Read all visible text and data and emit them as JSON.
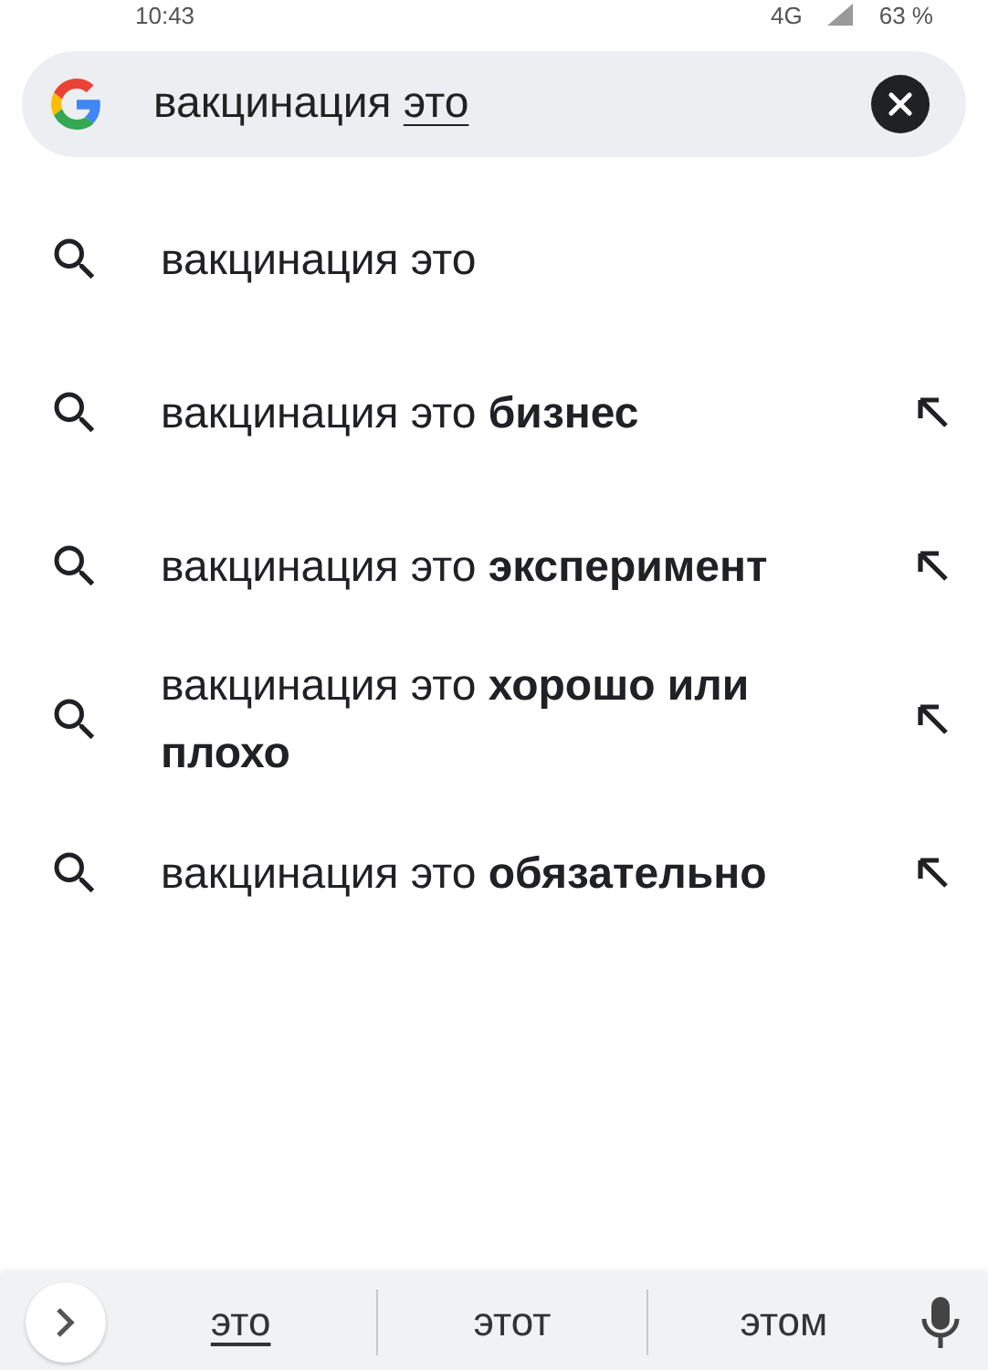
{
  "status_bar": {
    "time": "10:43",
    "network": "4G",
    "battery": "63 %"
  },
  "search": {
    "text": "вакцинация",
    "composing": "это"
  },
  "suggestions": [
    {
      "text": "вакцинация это",
      "fill_arrow": false
    },
    {
      "text": "вакцинация это **бизнес**",
      "fill_arrow": true
    },
    {
      "text": "вакцинация это **эксперимент**",
      "fill_arrow": true
    },
    {
      "text": "вакцинация это **хорошо или плохо**",
      "fill_arrow": true
    },
    {
      "text": "вакцинация это **обязательно**",
      "fill_arrow": true
    }
  ],
  "keyboard_suggestions": [
    {
      "label": "это",
      "underlined": true
    },
    {
      "label": "этот",
      "underlined": false
    },
    {
      "label": "этом",
      "underlined": false
    }
  ]
}
